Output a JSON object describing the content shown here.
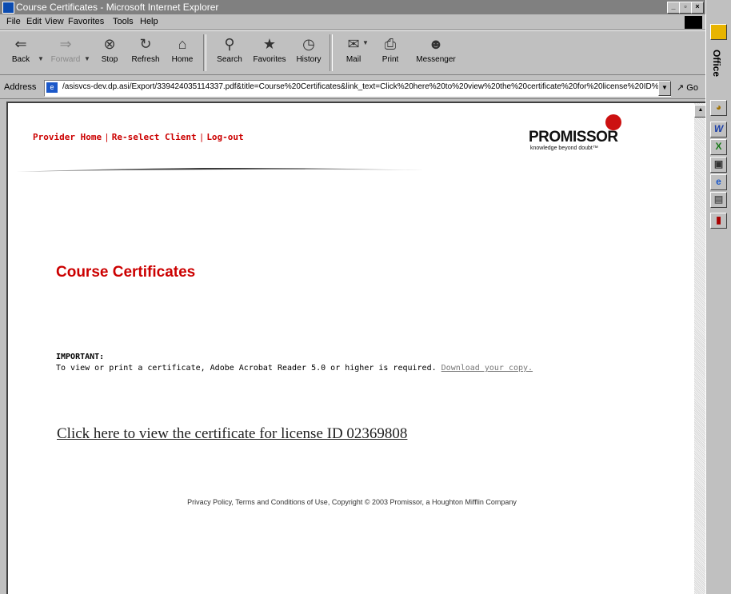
{
  "window": {
    "title": "Course Certificates - Microsoft Internet Explorer"
  },
  "menu": [
    "File",
    "Edit",
    "View",
    "Favorites",
    "Tools",
    "Help"
  ],
  "toolbar": {
    "back": "Back",
    "forward": "Forward",
    "stop": "Stop",
    "refresh": "Refresh",
    "home": "Home",
    "search": "Search",
    "favorites": "Favorites",
    "history": "History",
    "mail": "Mail",
    "print": "Print",
    "messenger": "Messenger"
  },
  "address": {
    "label": "Address",
    "url": "/asisvcs-dev.dp.asi/Export/339424035114337.pdf&title=Course%20Certificates&link_text=Click%20here%20to%20view%20the%20certificate%20for%20license%20ID%2002369808",
    "go": "Go"
  },
  "office": {
    "label": "Office"
  },
  "page": {
    "nav": {
      "provider_home": "Provider Home",
      "reselect_client": "Re-select Client",
      "logout": "Log-out"
    },
    "logo": {
      "wordmark": "PROMISSOR",
      "tagline": "knowledge beyond doubt™"
    },
    "title": "Course Certificates",
    "important_label": "IMPORTANT:",
    "requirement_text": "To view or print a certificate, Adobe Acrobat Reader 5.0 or higher is required.",
    "download_link": "Download your copy.",
    "certificate_link": "Click here to view the certificate for license ID 02369808",
    "footer": "Privacy Policy, Terms and Conditions of Use,  Copyright © 2003 Promissor,  a Houghton Mifflin Company"
  }
}
